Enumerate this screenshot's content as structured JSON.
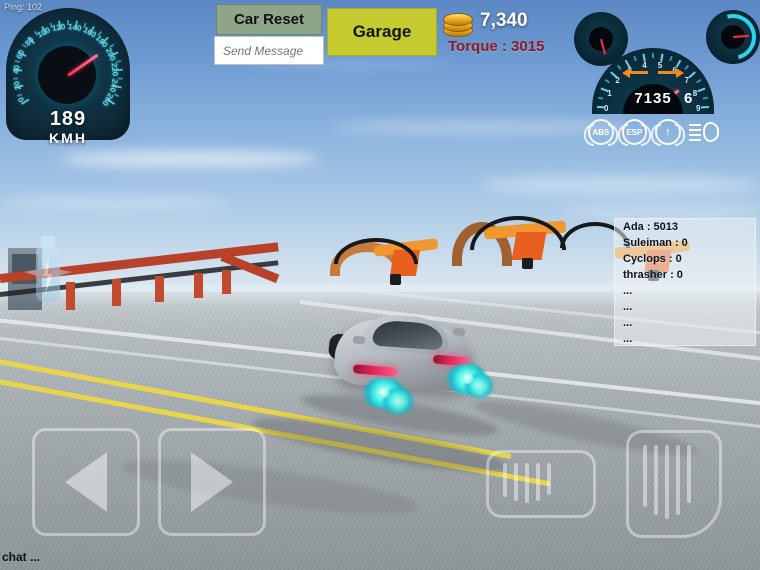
{
  "hud": {
    "ping_label": "Ping: 102",
    "chat_label": "chat ...",
    "speedometer": {
      "value": "189",
      "unit": "KMH",
      "ticks": [
        "0",
        "20",
        "40",
        "60",
        "80",
        "100",
        "120",
        "140",
        "160",
        "180",
        "200",
        "220",
        "240",
        "260"
      ],
      "needle_value": 189,
      "max": 260
    },
    "tachometer": {
      "rpm": "7135",
      "gear": "6",
      "ticks": [
        "0",
        "1",
        "2",
        "3",
        "4",
        "5",
        "6",
        "7",
        "8",
        "9"
      ],
      "needle_value": 7135,
      "max": 9000
    },
    "indicators": [
      {
        "name": "abs-indicator",
        "label": "ABS"
      },
      {
        "name": "esp-indicator",
        "label": "ESP"
      },
      {
        "name": "brake-warning-indicator",
        "label": "!"
      },
      {
        "name": "headlight-indicator",
        "label": ""
      }
    ]
  },
  "toolbar": {
    "car_reset_label": "Car Reset",
    "garage_label": "Garage",
    "message_placeholder": "Send Message",
    "message_value": "",
    "coins": "7,340",
    "torque": "Torque : 3015"
  },
  "leaderboard": {
    "rows": [
      "Ada :  5013",
      "Suleiman :  0",
      "Cyclops :  0",
      "thrasher :  0",
      "...",
      "...",
      "...",
      "..."
    ]
  },
  "controls": {
    "steer_left": "steer-left",
    "steer_right": "steer-right",
    "brake": "brake-pedal",
    "gas": "gas-pedal",
    "nitro": "nitro-boost"
  },
  "colors": {
    "car_reset_bg": "#8fa58a",
    "garage_bg": "#c5cb2e",
    "torque_text": "#8f1b23",
    "gauge_accent": "#5fd8e8",
    "needle": "#ff2b4a",
    "nitro_flame": "#49f2e6",
    "coin": "#e8a51d"
  }
}
